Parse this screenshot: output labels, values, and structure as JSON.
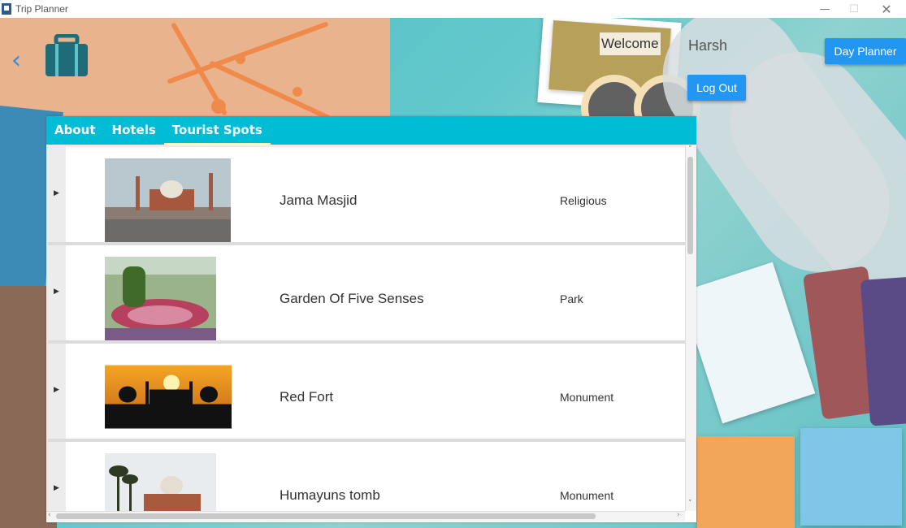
{
  "window": {
    "title": "Trip Planner"
  },
  "header": {
    "welcome_label": "Welcome",
    "username": "Harsh",
    "day_planner_button": "Day Planner",
    "logout_button": "Log Out"
  },
  "tabs": [
    {
      "label": "About",
      "active": false
    },
    {
      "label": "Hotels",
      "active": false
    },
    {
      "label": "Tourist Spots",
      "active": true
    }
  ],
  "spots": [
    {
      "name": "Jama Masjid",
      "category": "Religious"
    },
    {
      "name": "Garden Of Five Senses",
      "category": "Park"
    },
    {
      "name": "Red Fort",
      "category": "Monument"
    },
    {
      "name": "Humayuns tomb",
      "category": "Monument"
    }
  ],
  "colors": {
    "tab_bar": "#00bcd4",
    "button": "#2196f3",
    "active_tab_underline": "#fff59d"
  }
}
